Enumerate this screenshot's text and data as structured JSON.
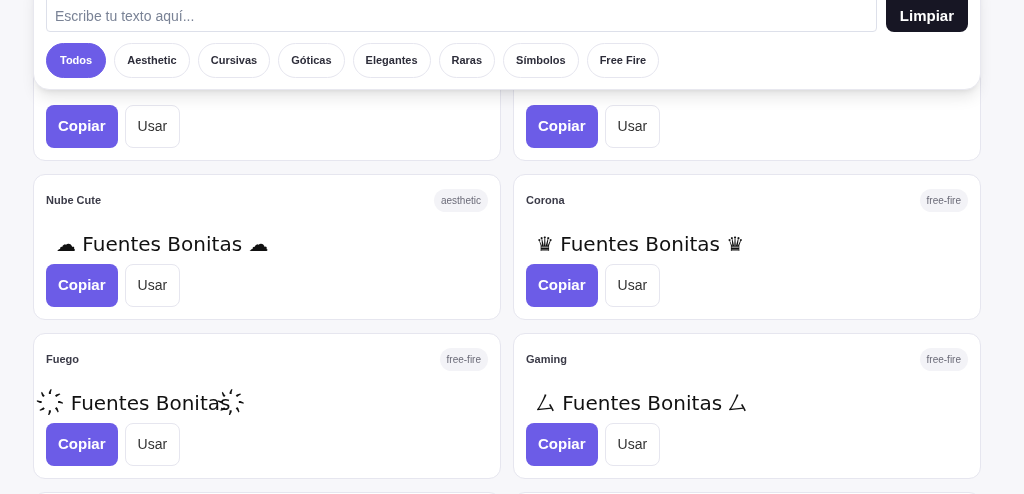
{
  "search": {
    "placeholder": "Escribe tu texto aquí...",
    "button": "Limpiar"
  },
  "filters": [
    {
      "label": "Todos",
      "selected": true
    },
    {
      "label": "Aesthetic",
      "selected": false
    },
    {
      "label": "Cursivas",
      "selected": false
    },
    {
      "label": "Góticas",
      "selected": false
    },
    {
      "label": "Elegantes",
      "selected": false
    },
    {
      "label": "Raras",
      "selected": false
    },
    {
      "label": "Símbolos",
      "selected": false
    },
    {
      "label": "Free Fire",
      "selected": false
    }
  ],
  "cards": [
    {
      "actions": [
        {
          "label": "Copiar",
          "kind": "primary"
        },
        {
          "label": "Usar",
          "kind": "secondary"
        }
      ]
    },
    {
      "actions": [
        {
          "label": "Copiar",
          "kind": "primary"
        },
        {
          "label": "Usar",
          "kind": "secondary"
        }
      ]
    },
    {
      "title": "Nube Cute",
      "tag": "aesthetic",
      "preview": "☁ Fuentes Bonitas ☁",
      "actions": [
        {
          "label": "Copiar",
          "kind": "primary"
        },
        {
          "label": "Usar",
          "kind": "secondary"
        }
      ]
    },
    {
      "title": "Corona",
      "tag": "free-fire",
      "preview": "♛ Fuentes Bonitas ♛",
      "actions": [
        {
          "label": "Copiar",
          "kind": "primary"
        },
        {
          "label": "Usar",
          "kind": "secondary"
        }
      ]
    },
    {
      "title": "Fuego",
      "tag": "free-fire",
      "preview": "҉ Fuentes Bonitas ҉",
      "actions": [
        {
          "label": "Copiar",
          "kind": "primary"
        },
        {
          "label": "Usar",
          "kind": "secondary"
        }
      ]
    },
    {
      "title": "Gaming",
      "tag": "free-fire",
      "preview": "厶 Fuentes Bonitas 厶",
      "actions": [
        {
          "label": "Copiar",
          "kind": "primary"
        },
        {
          "label": "Usar",
          "kind": "secondary"
        }
      ]
    }
  ]
}
